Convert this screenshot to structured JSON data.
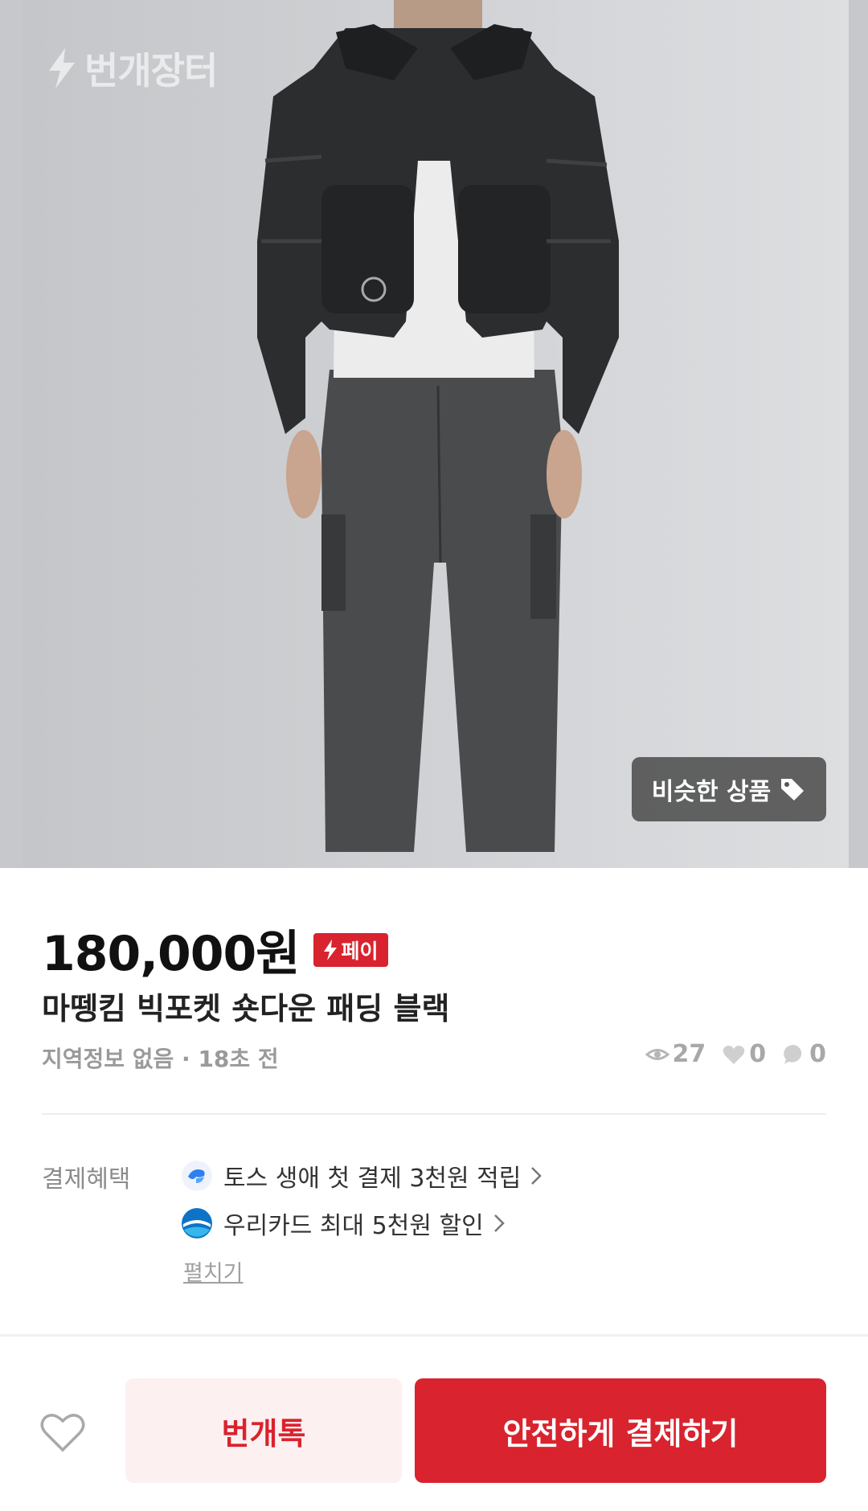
{
  "app": {
    "watermark_text": "번개장터",
    "accent_color": "#d9232e"
  },
  "hero": {
    "similar_button_label": "비슷한 상품",
    "similar_button_icon": "tag-icon"
  },
  "product": {
    "price": "180,000원",
    "pay_badge": "페이",
    "title": "마뗑킴 빅포켓 숏다운 패딩 블랙",
    "location_time": "지역정보 없음 · 18초 전",
    "views": "27",
    "likes": "0",
    "chats": "0"
  },
  "benefits": {
    "label": "결제혜택",
    "items": [
      {
        "text": "토스 생애 첫 결제 3천원 적립",
        "icon": "toss-logo-icon"
      },
      {
        "text": "우리카드 최대 5천원 할인",
        "icon": "woori-card-logo-icon"
      }
    ],
    "expand_label": "펼치기"
  },
  "actions": {
    "chat_label": "번개톡",
    "buy_label": "안전하게 결제하기"
  }
}
